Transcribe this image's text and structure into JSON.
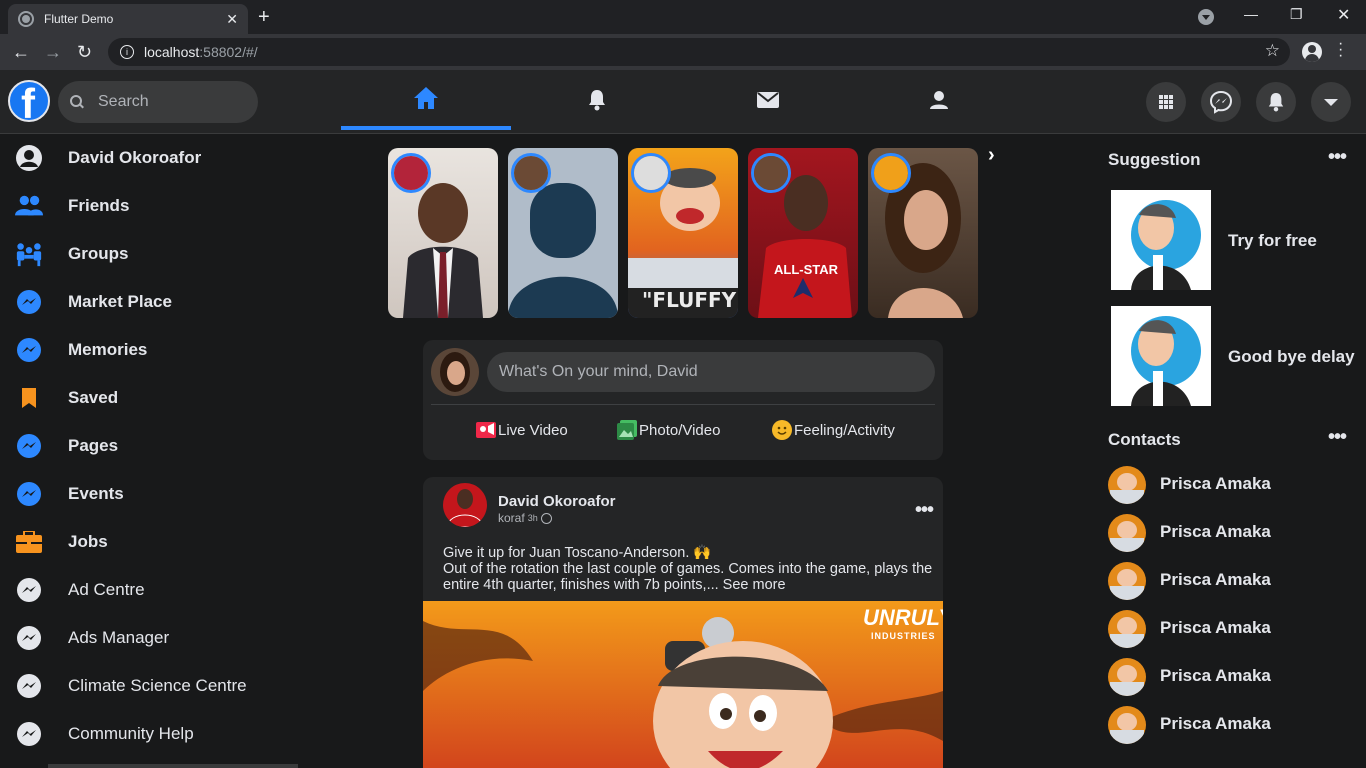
{
  "browser": {
    "tab_title": "Flutter Demo",
    "url_host": "localhost",
    "url_rest": ":58802/#/"
  },
  "header": {
    "search_placeholder": "Search"
  },
  "sidebar": {
    "items": [
      {
        "label": "David Okoroafor",
        "icon": "user-icon"
      },
      {
        "label": "Friends",
        "icon": "friends-icon"
      },
      {
        "label": "Groups",
        "icon": "groups-icon"
      },
      {
        "label": "Market Place",
        "icon": "messenger-icon"
      },
      {
        "label": "Memories",
        "icon": "messenger-icon"
      },
      {
        "label": "Saved",
        "icon": "bookmark-icon"
      },
      {
        "label": "Pages",
        "icon": "messenger-icon"
      },
      {
        "label": "Events",
        "icon": "messenger-icon"
      },
      {
        "label": "Jobs",
        "icon": "briefcase-icon"
      },
      {
        "label": "Ad Centre",
        "icon": "messenger-icon"
      },
      {
        "label": "Ads Manager",
        "icon": "messenger-icon"
      },
      {
        "label": "Climate Science Centre",
        "icon": "messenger-icon"
      },
      {
        "label": "Community Help",
        "icon": "messenger-icon"
      }
    ]
  },
  "create_post": {
    "placeholder": "What's On your mind, David",
    "actions": [
      "Live Video",
      "Photo/Video",
      "Feeling/Activity"
    ]
  },
  "post": {
    "author": "David Okoroafor",
    "handle": "koraf",
    "time": "3h",
    "line1": "Give it up for Juan Toscano-Anderson. 🙌",
    "line2": "Out of the rotation the last couple of games. Comes into the game, plays the entire 4th quarter, finishes with 7b points,... See more",
    "image_brand": "UNRULY",
    "image_brand_sub": "INDUSTRIES"
  },
  "stories": {
    "fluffy_text": "\"FLUFFY\"",
    "allstar_text": "ALL-STAR"
  },
  "right": {
    "suggestion_heading": "Suggestion",
    "suggestions": [
      "Try for free",
      "Good bye delay"
    ],
    "contacts_heading": "Contacts",
    "contacts": [
      "Prisca Amaka",
      "Prisca Amaka",
      "Prisca Amaka",
      "Prisca Amaka",
      "Prisca Amaka",
      "Prisca Amaka"
    ]
  },
  "colors": {
    "accent": "#2d88ff",
    "background": "#18191a",
    "card": "#242526"
  }
}
